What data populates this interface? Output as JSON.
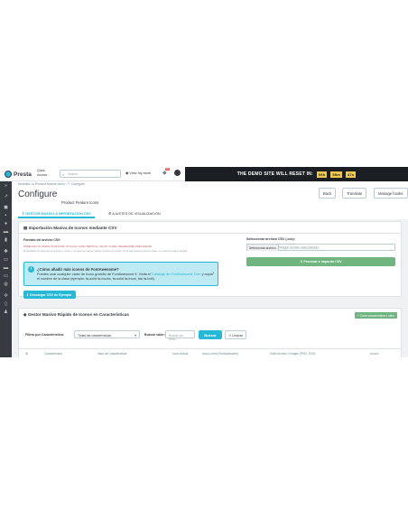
{
  "topbar": {
    "logo": "Presta",
    "quick_access": [
      "Quick",
      "Access"
    ],
    "search_placeholder": "Search",
    "view_store": "View my store",
    "notif_count": "10",
    "demo_text": "THE DEMO SITE WILL RESET IN:",
    "timer": [
      "09h",
      "55m",
      "47s"
    ]
  },
  "header": {
    "breadcrumb": "Modules / ▸ Product feature icons / ✎ Configure",
    "title": "Configure",
    "subtitle": "Product Feature Icons",
    "buttons": [
      "Back",
      "Translate",
      "Manage hooks"
    ]
  },
  "tabs": [
    {
      "label": "GESTOR MASIVO & IMPORTACIÓN CSV",
      "active": true
    },
    {
      "label": "AJUSTES DE VISUALIZACIÓN",
      "active": false
    }
  ],
  "import_panel": {
    "title": "Importación Masiva de Iconos mediante CSV",
    "format_label": "Formato del archivo CSV:",
    "required_cols": "ORDEN DE COLUMNAS: ID FEATURE, ID VALUE, CARACTERISTICA, VALOR, CLASE LINEAWESOME, PRES IMAGEN",
    "help": "El separador de columnas es el punto y coma (;). La columna 'Imagen' admite nombres de archivo. Si se deja vacía la columna 'Clase', se usará la imagen cargada.",
    "fa_title": "¿Cómo añadir más iconos de FontAwesome?",
    "fa_text_a": "Puedes usar cualquier clase de icono gratuito de FontAwesome 6. Visita el ",
    "fa_link": "Catálogo de FontAwesome Free",
    "fa_text_b": " y copia el nombre de la clase (ejemplo: fa-solid fa-trucks, fa-solid fa-truck, fas fa-bolt).",
    "download_btn": "Descargar CSV de Ejemplo",
    "file_label": "Seleccionar archivo CSV (.csv):",
    "file_btn": "Seleccionar archivo",
    "file_status": "Ningún archivo seleccionado",
    "process_btn": "Procesar e Importar CSV"
  },
  "manager_panel": {
    "title": "Gestor Masivo Rápido de Iconos en Características",
    "add_btn": "Crear característica o valor",
    "filter_label": "Filtrar por Característica:",
    "filter_select": "Todas las características",
    "search_label": "Buscar valor:",
    "search_placeholder": "Buscar por texto...",
    "buscar_btn": "Buscar",
    "limpiar_btn": "Limpiar",
    "columns": [
      "ID",
      "Característica",
      "Valor de Característica",
      "Icono Actual",
      "Icono Línea (FontAwesome)",
      "Subir Archivo / Imagen (PNG, SVG)",
      "Acción"
    ]
  },
  "colors": {
    "accent": "#25b9d7",
    "success": "#70b580",
    "sidebar": "#363a41"
  }
}
